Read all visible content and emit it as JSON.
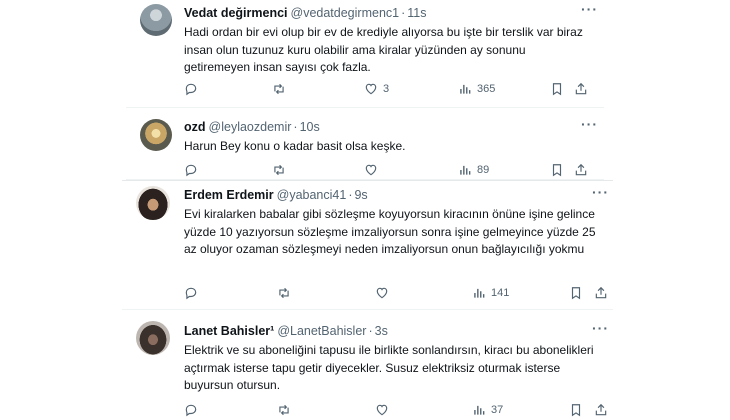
{
  "tweets": [
    {
      "name": "Vedat değirmenci",
      "handle": "@vedatdegirmenc1",
      "time": "11s",
      "text": "Hadi ordan bir evi olup bir ev de krediyle alıyorsa bu işte bir terslik var biraz insan olun tuzunuz kuru olabilir ama kiralar yüzünden ay sonunu getiremeyen insan sayısı çok fazla.",
      "likes": "3",
      "views": "365"
    },
    {
      "name": "ozd",
      "handle": "@leylaozdemir",
      "time": "10s",
      "text": "Harun Bey konu o kadar basit olsa keşke.",
      "likes": "",
      "views": "89"
    },
    {
      "name": "Erdem Erdemir",
      "handle": "@yabanci41",
      "time": "9s",
      "text": "Evi kiralarken babalar gibi sözleşme koyuyorsun kiracının önüne işine gelince yüzde 10 yazıyorsun sözleşme imzaliyorsun sonra işine gelmeyince yüzde 25 az oluyor ozaman sözleşmeyi neden imzaliyorsun onun bağlayıcılığı yokmu",
      "likes": "",
      "views": "141"
    },
    {
      "name": "Lanet Bahisler¹",
      "handle": "@LanetBahisler",
      "time": "3s",
      "text": "Elektrik ve su aboneliğini tapusu ile birlikte sonlandırsın, kiracı bu abonelikleri açtırmak isterse tapu getir diyecekler. Susuz elektriksiz oturmak isterse buyursun otursun.",
      "likes": "",
      "views": "37"
    }
  ],
  "icons": [
    "reply-icon",
    "retweet-icon",
    "like-icon",
    "views-icon",
    "bookmark-icon",
    "share-icon",
    "more-icon"
  ],
  "colors": {
    "text": "#0f1419",
    "muted": "#536471",
    "divider": "#eff3f4"
  }
}
